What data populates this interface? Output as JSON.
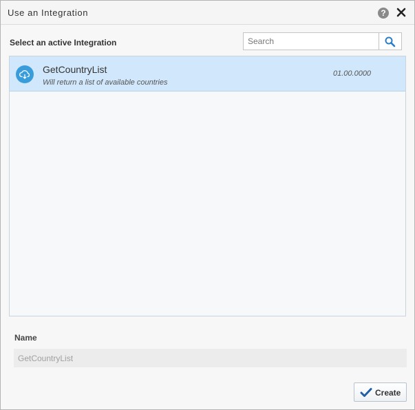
{
  "dialog": {
    "title": "Use an Integration",
    "help_icon": "question-mark-icon",
    "help_glyph": "?",
    "close_icon": "close-icon"
  },
  "integration_list": {
    "label": "Select an active Integration",
    "search": {
      "placeholder": "Search",
      "value": "",
      "icon": "search-icon"
    },
    "items": [
      {
        "name": "GetCountryList",
        "description": "Will return a list of available countries",
        "version": "01.00.0000",
        "icon": "cloud-integration-icon",
        "selected": true
      }
    ]
  },
  "name_field": {
    "label": "Name",
    "value": "GetCountryList"
  },
  "footer": {
    "create_label": "Create",
    "create_icon": "checkmark-icon"
  },
  "colors": {
    "accent": "#3a9ddb",
    "selected_row": "#d1e7fb",
    "checkmark": "#1f5fa8"
  }
}
